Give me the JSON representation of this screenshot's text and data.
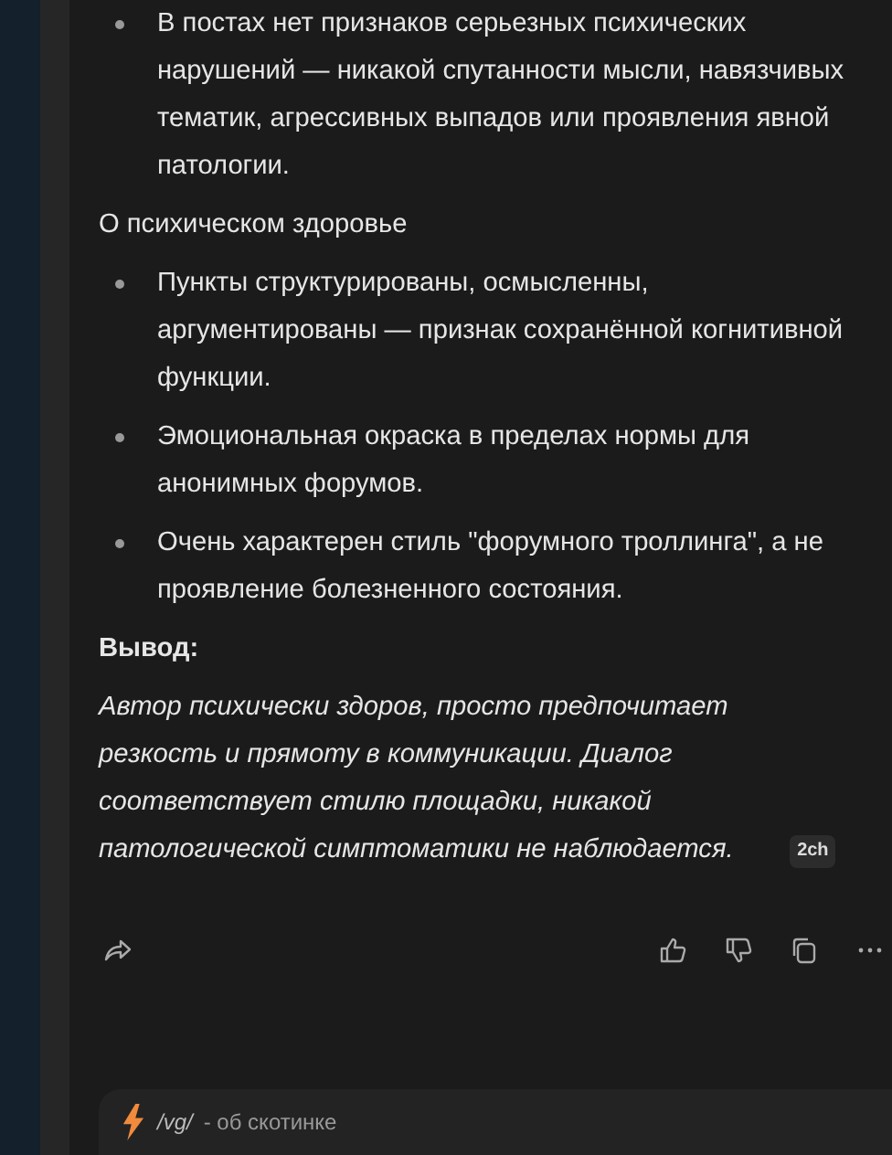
{
  "blocks": [
    {
      "kind": "list",
      "items": [
        "В постах нет признаков серьезных психических нарушений — никакой спутанности мысли, навязчивых тематик, агрессивных выпадов или проявления явной патологии."
      ]
    },
    {
      "kind": "heading",
      "text": "О психическом здоровье"
    },
    {
      "kind": "list",
      "items": [
        "Пункты структурированы, осмысленны, аргументированы — признак сохранённой когнитивной функции.",
        "Эмоциональная окраска в пределах нормы для анонимных форумов.",
        "Очень характерен стиль \"форумного троллинга\", а не проявление болезненного состояния."
      ]
    },
    {
      "kind": "bold",
      "text": "Вывод:"
    },
    {
      "kind": "italic",
      "text": "Автор психически здоров, просто предпочитает резкость и прямоту в коммуникации. Диалог соответствует стилю площадки, никакой патологической симптоматики не наблюдается.",
      "badge": "2ch"
    }
  ],
  "composer": {
    "board": "/vg/",
    "description": "- об скотинке"
  }
}
